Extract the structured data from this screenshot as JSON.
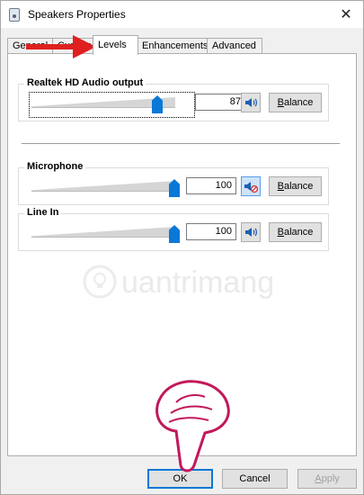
{
  "window": {
    "title": "Speakers Properties",
    "close_glyph": "✕"
  },
  "tabs": [
    {
      "label": "General",
      "active": false
    },
    {
      "label": "Custom",
      "active": false
    },
    {
      "label": "Levels",
      "active": true
    },
    {
      "label": "Enhancements",
      "active": false
    },
    {
      "label": "Advanced",
      "active": false
    }
  ],
  "levels": [
    {
      "name": "Realtek HD Audio output",
      "value": "87",
      "level": 87,
      "muted": false,
      "balance_label_u": "B",
      "balance_label_rest": "alance",
      "icon": "speaker-icon"
    },
    {
      "name": "Microphone",
      "value": "100",
      "level": 100,
      "muted": true,
      "balance_label_u": "B",
      "balance_label_rest": "alance",
      "icon": "speaker-muted-icon"
    },
    {
      "name": "Line In",
      "value": "100",
      "level": 100,
      "muted": false,
      "balance_label_u": "B",
      "balance_label_rest": "alance",
      "icon": "speaker-icon"
    }
  ],
  "watermark": {
    "text": "uantrimang",
    "icon": "lightbulb-icon"
  },
  "footer": {
    "ok_label": "OK",
    "cancel_label": "Cancel",
    "apply_label_u": "A",
    "apply_label_rest": "pply"
  },
  "annotations": {
    "arrow": "red-arrow-icon",
    "hand": "pointing-hand-icon",
    "arrow_color": "#e02020",
    "hand_color": "#c2185b"
  },
  "colors": {
    "accent": "#0a78d7",
    "focus": "#0078d7",
    "panel_bg": "#ffffff",
    "window_bg": "#f0f0f0"
  }
}
